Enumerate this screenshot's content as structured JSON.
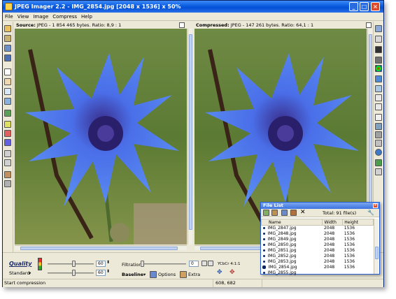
{
  "window": {
    "title": "JPEG Imager 2.2 - IMG_2854.jpg [2048 x 1536] x 50%"
  },
  "menu": [
    {
      "label": "File"
    },
    {
      "label": "View"
    },
    {
      "label": "Image"
    },
    {
      "label": "Compress"
    },
    {
      "label": "Help"
    }
  ],
  "source_pane": {
    "label": "Source:",
    "info": "JPEG - 1 854 465 bytes. Ratio: 8,9 : 1"
  },
  "compressed_pane": {
    "label": "Compressed:",
    "info": "JPEG - 147 261 bytes. Ratio: 64,1 : 1"
  },
  "controls": {
    "quality_label": "Quality",
    "standard_label": "Standard",
    "quality_value_1": "60",
    "quality_value_2": "60",
    "filtration_label": "Filtration",
    "filtration_value": "0",
    "smooth_value": "0",
    "baseline_label": "Baseline",
    "options_label": "Options",
    "extra_label": "Extra",
    "subsampling_label": "YCbCr 4:1:1"
  },
  "file_list": {
    "title": "File List",
    "total_label": "Total: 91 file(s)",
    "columns": [
      "Name",
      "Width",
      "Height"
    ],
    "rows": [
      {
        "name": "IMG_2847.jpg",
        "width": "2048",
        "height": "1536"
      },
      {
        "name": "IMG_2848.jpg",
        "width": "2048",
        "height": "1536"
      },
      {
        "name": "IMG_2849.jpg",
        "width": "2048",
        "height": "1536"
      },
      {
        "name": "IMG_2850.jpg",
        "width": "2048",
        "height": "1536"
      },
      {
        "name": "IMG_2851.jpg",
        "width": "2048",
        "height": "1536"
      },
      {
        "name": "IMG_2852.jpg",
        "width": "2048",
        "height": "1536"
      },
      {
        "name": "IMG_2853.jpg",
        "width": "2048",
        "height": "1536"
      },
      {
        "name": "IMG_2854.jpg",
        "width": "2048",
        "height": "1536"
      },
      {
        "name": "IMG_2855.jpg",
        "width": "",
        "height": ""
      }
    ],
    "selected_row": 7
  },
  "status": {
    "message": "Start compression",
    "coords": "608, 682"
  }
}
